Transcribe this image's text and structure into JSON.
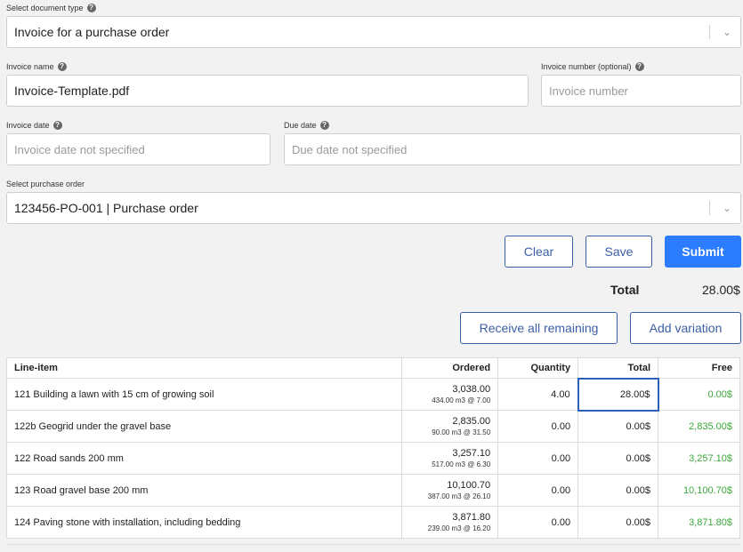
{
  "doc_type": {
    "label": "Select document type",
    "value": "Invoice for a purchase order"
  },
  "invoice_name": {
    "label": "Invoice name",
    "value": "Invoice-Template.pdf"
  },
  "invoice_number": {
    "label": "Invoice number (optional)",
    "placeholder": "Invoice number"
  },
  "invoice_date": {
    "label": "Invoice date",
    "placeholder": "Invoice date not specified"
  },
  "due_date": {
    "label": "Due date",
    "placeholder": "Due date not specified"
  },
  "purchase_order": {
    "label": "Select purchase order",
    "value": "123456-PO-001 | Purchase order"
  },
  "buttons": {
    "clear": "Clear",
    "save": "Save",
    "submit": "Submit",
    "receive_all": "Receive all remaining",
    "add_variation": "Add variation"
  },
  "total": {
    "label": "Total",
    "value": "28.00$"
  },
  "table": {
    "headers": {
      "item": "Line-item",
      "ordered": "Ordered",
      "quantity": "Quantity",
      "total": "Total",
      "free": "Free"
    },
    "rows": [
      {
        "item": "121 Building a lawn with 15 cm of growing soil",
        "ordered": "3,038.00",
        "ordered_detail": "434.00 m3 @ 7.00",
        "quantity": "4.00",
        "total": "28.00$",
        "free": "0.00$"
      },
      {
        "item": "122b Geogrid under the gravel base",
        "ordered": "2,835.00",
        "ordered_detail": "90.00 m3 @ 31.50",
        "quantity": "0.00",
        "total": "0.00$",
        "free": "2,835.00$"
      },
      {
        "item": "122 Road sands 200 mm",
        "ordered": "3,257.10",
        "ordered_detail": "517.00 m3 @ 6.30",
        "quantity": "0.00",
        "total": "0.00$",
        "free": "3,257.10$"
      },
      {
        "item": "123 Road gravel base 200 mm",
        "ordered": "10,100.70",
        "ordered_detail": "387.00 m3 @ 26.10",
        "quantity": "0.00",
        "total": "0.00$",
        "free": "10,100.70$"
      },
      {
        "item": "124 Paving stone with installation, including bedding",
        "ordered": "3,871.80",
        "ordered_detail": "239.00 m3 @ 16.20",
        "quantity": "0.00",
        "total": "0.00$",
        "free": "3,871.80$"
      }
    ]
  },
  "colors": {
    "primary": "#2b7cff",
    "outline": "#3b5fa6",
    "free_green": "#3aa83a"
  },
  "icons": {
    "help": "help-icon",
    "chevron": "chevron-down-icon"
  }
}
